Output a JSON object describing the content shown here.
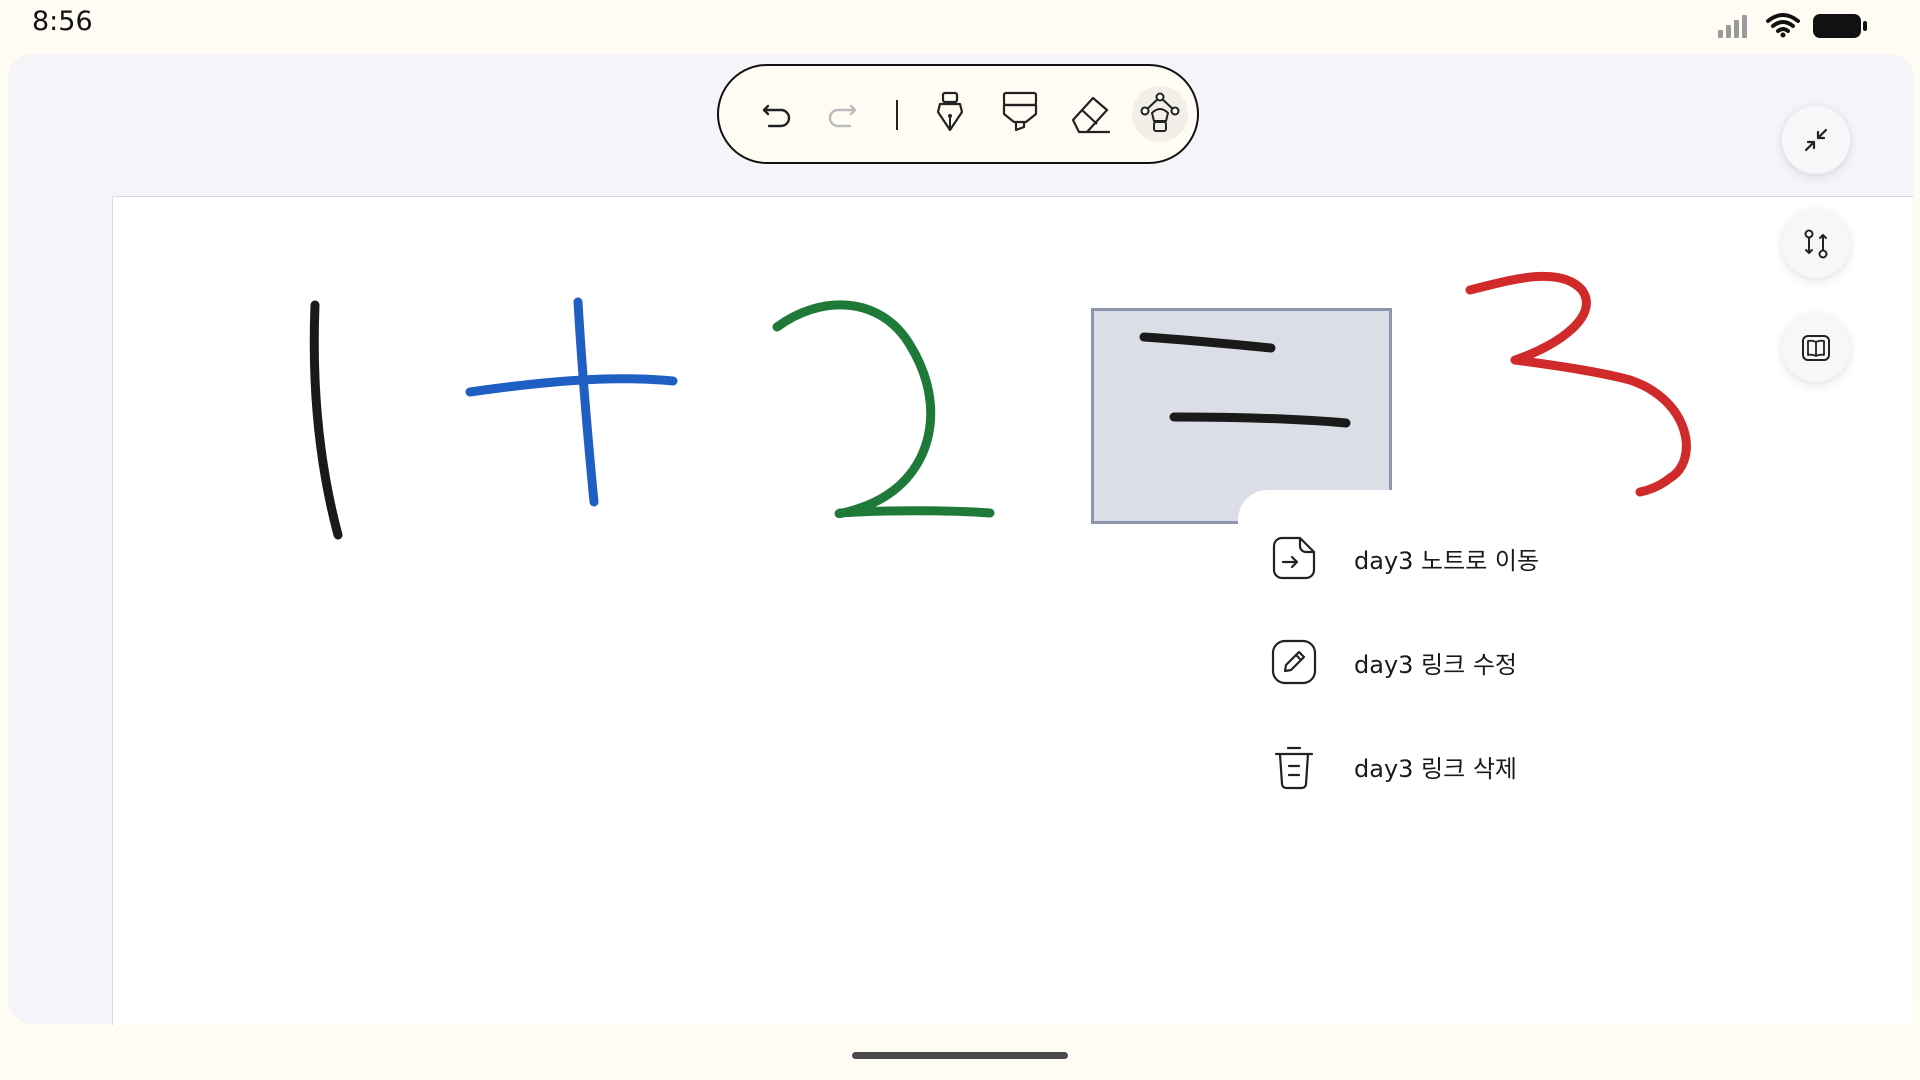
{
  "status_bar": {
    "time": "8:56",
    "icons": [
      "signal-icon",
      "wifi-icon",
      "battery-icon"
    ]
  },
  "toolbar": {
    "tools": [
      "undo-icon",
      "redo-icon",
      "pen-icon",
      "highlighter-icon",
      "eraser-icon",
      "lasso-icon"
    ],
    "active_tool": "lasso-icon"
  },
  "side_buttons": [
    "minimize-icon",
    "swap-link-icon",
    "book-icon"
  ],
  "canvas": {
    "strokes": [
      {
        "glyph": "1",
        "color": "#1a1a1a"
      },
      {
        "glyph": "+",
        "color": "#1f5fc4"
      },
      {
        "glyph": "2",
        "color": "#1f7a3a"
      },
      {
        "glyph": "=",
        "color": "#1a1a1a"
      },
      {
        "glyph": "3",
        "color": "#d12a2a"
      }
    ],
    "link_highlight_color": "#cdd1de"
  },
  "context_menu": {
    "items": [
      {
        "icon": "move-note-icon",
        "label": "day3 노트로 이동"
      },
      {
        "icon": "edit-icon",
        "label": "day3 링크 수정"
      },
      {
        "icon": "trash-icon",
        "label": "day3 링크 삭제"
      }
    ]
  }
}
